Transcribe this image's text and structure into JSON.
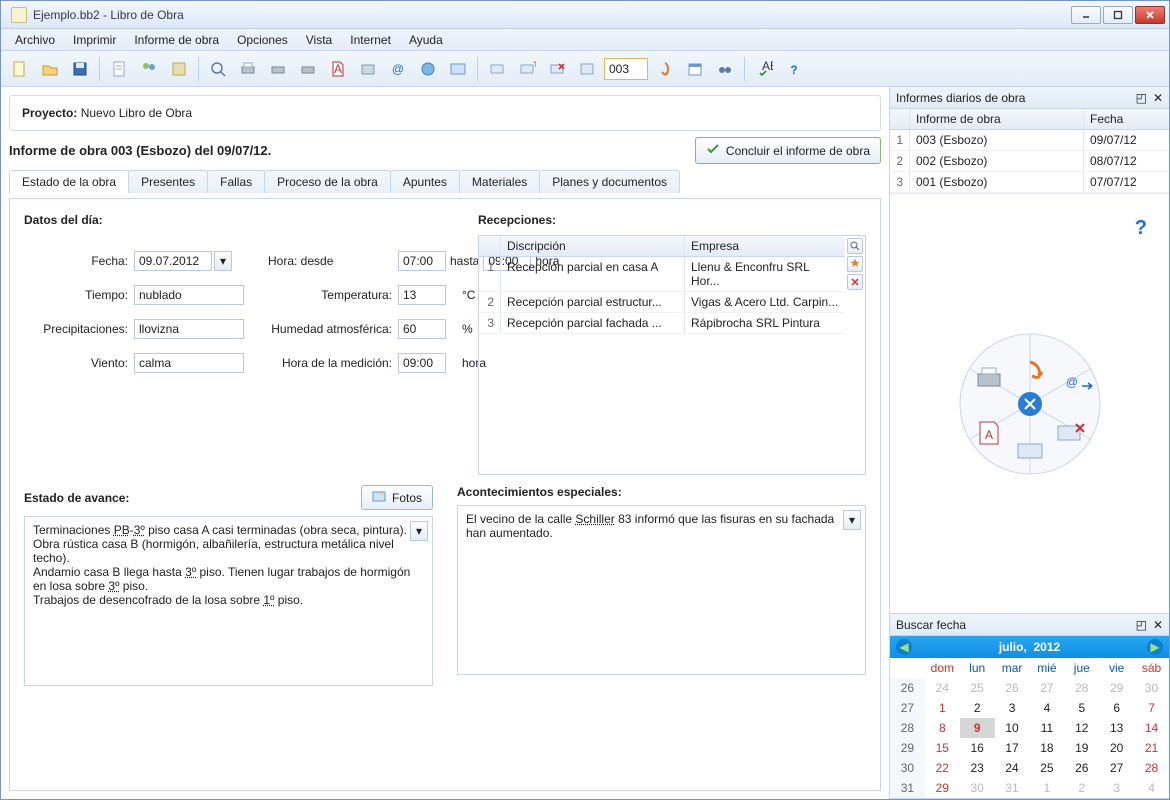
{
  "window": {
    "title": "Ejemplo.bb2 - Libro de Obra"
  },
  "menu": [
    "Archivo",
    "Imprimir",
    "Informe de obra",
    "Opciones",
    "Vista",
    "Internet",
    "Ayuda"
  ],
  "toolbar_page": "003",
  "project": {
    "label": "Proyecto:",
    "name": "Nuevo Libro de Obra"
  },
  "report_title": "Informe de obra 003 (Esbozo) del 09/07/12.",
  "conclude_btn": "Concluir el informe de obra",
  "tabs": [
    "Estado de la obra",
    "Presentes",
    "Fallas",
    "Proceso de la obra",
    "Apuntes",
    "Materiales",
    "Planes y documentos"
  ],
  "datos": {
    "heading": "Datos del día:",
    "fecha_lbl": "Fecha:",
    "fecha": "09.07.2012",
    "hora_lbl": "Hora: desde",
    "hora_desde": "07:00",
    "hasta_lbl": "hasta",
    "hora_hasta": "09:00",
    "hora_unit": "hora",
    "tiempo_lbl": "Tiempo:",
    "tiempo": "nublado",
    "temp_lbl": "Temperatura:",
    "temp": "13",
    "temp_unit": "°C",
    "precip_lbl": "Precipitaciones:",
    "precip": "llovizna",
    "hum_lbl": "Humedad atmosférica:",
    "hum": "60",
    "hum_unit": "%",
    "viento_lbl": "Viento:",
    "viento": "calma",
    "med_lbl": "Hora de la medición:",
    "med": "09:00",
    "med_unit": "hora"
  },
  "recepciones": {
    "heading": "Recepciones:",
    "cols": {
      "c1": "Discripción",
      "c2": "Empresa"
    },
    "rows": [
      {
        "n": "1",
        "c1": "Recepción parcial en casa A",
        "c2": "Llenu & Enconfru SRL  Hor..."
      },
      {
        "n": "2",
        "c1": "Recepción parcial estructur...",
        "c2": "Vigas & Acero Ltd.  Carpin..."
      },
      {
        "n": "3",
        "c1": "Recepción parcial fachada ...",
        "c2": "Rápibrocha SRL  Pintura"
      }
    ]
  },
  "avance": {
    "heading": "Estado de avance:",
    "fotos_btn": "Fotos",
    "text_html": "Terminaciones <u class=d>PB</u>-<u class=d>3º</u> piso casa A casi terminadas (obra seca, pintura).<br>Obra rústica casa B (hormigón, albañilería, estructura metálica nivel techo).<br>Andamio casa B llega hasta <u class=d>3º</u> piso. Tienen lugar trabajos de hormigón en losa sobre <u class=d>3º</u> piso.<br>Trabajos de desencofrado de la losa sobre <u class=d>1º</u> piso."
  },
  "especiales": {
    "heading": "Acontecimientos especiales:",
    "text_html": "El vecino de la calle <u class=d>Schiller</u> 83 informó que las fisuras en su fachada han aumentado."
  },
  "side": {
    "reports_title": "Informes diarios de obra",
    "cols": {
      "c1": "Informe de obra",
      "c2": "Fecha"
    },
    "rows": [
      {
        "n": "1",
        "c1": "003 (Esbozo)",
        "c2": "09/07/12"
      },
      {
        "n": "2",
        "c1": "002 (Esbozo)",
        "c2": "08/07/12"
      },
      {
        "n": "3",
        "c1": "001 (Esbozo)",
        "c2": "07/07/12"
      }
    ],
    "search_title": "Buscar  fecha"
  },
  "cal": {
    "month": "julio,",
    "year": "2012",
    "dow": [
      "dom",
      "lun",
      "mar",
      "mié",
      "jue",
      "vie",
      "sáb"
    ],
    "weeks": [
      {
        "wk": "26",
        "d": [
          {
            "v": "24",
            "c": "dim"
          },
          {
            "v": "25",
            "c": "dim"
          },
          {
            "v": "26",
            "c": "dim"
          },
          {
            "v": "27",
            "c": "dim"
          },
          {
            "v": "28",
            "c": "dim"
          },
          {
            "v": "29",
            "c": "dim"
          },
          {
            "v": "30",
            "c": "dim"
          }
        ]
      },
      {
        "wk": "27",
        "d": [
          {
            "v": "1",
            "c": "red"
          },
          {
            "v": "2",
            "c": ""
          },
          {
            "v": "3",
            "c": ""
          },
          {
            "v": "4",
            "c": ""
          },
          {
            "v": "5",
            "c": ""
          },
          {
            "v": "6",
            "c": ""
          },
          {
            "v": "7",
            "c": "red"
          }
        ]
      },
      {
        "wk": "28",
        "d": [
          {
            "v": "8",
            "c": "red"
          },
          {
            "v": "9",
            "c": "sel"
          },
          {
            "v": "10",
            "c": ""
          },
          {
            "v": "11",
            "c": ""
          },
          {
            "v": "12",
            "c": ""
          },
          {
            "v": "13",
            "c": ""
          },
          {
            "v": "14",
            "c": "red"
          }
        ]
      },
      {
        "wk": "29",
        "d": [
          {
            "v": "15",
            "c": "red"
          },
          {
            "v": "16",
            "c": ""
          },
          {
            "v": "17",
            "c": ""
          },
          {
            "v": "18",
            "c": ""
          },
          {
            "v": "19",
            "c": ""
          },
          {
            "v": "20",
            "c": ""
          },
          {
            "v": "21",
            "c": "red"
          }
        ]
      },
      {
        "wk": "30",
        "d": [
          {
            "v": "22",
            "c": "red"
          },
          {
            "v": "23",
            "c": ""
          },
          {
            "v": "24",
            "c": ""
          },
          {
            "v": "25",
            "c": ""
          },
          {
            "v": "26",
            "c": ""
          },
          {
            "v": "27",
            "c": ""
          },
          {
            "v": "28",
            "c": "red"
          }
        ]
      },
      {
        "wk": "31",
        "d": [
          {
            "v": "29",
            "c": "red"
          },
          {
            "v": "30",
            "c": "dim"
          },
          {
            "v": "31",
            "c": "dim"
          },
          {
            "v": "1",
            "c": "dim"
          },
          {
            "v": "2",
            "c": "dim"
          },
          {
            "v": "3",
            "c": "dim"
          },
          {
            "v": "4",
            "c": "dim"
          }
        ]
      }
    ]
  }
}
